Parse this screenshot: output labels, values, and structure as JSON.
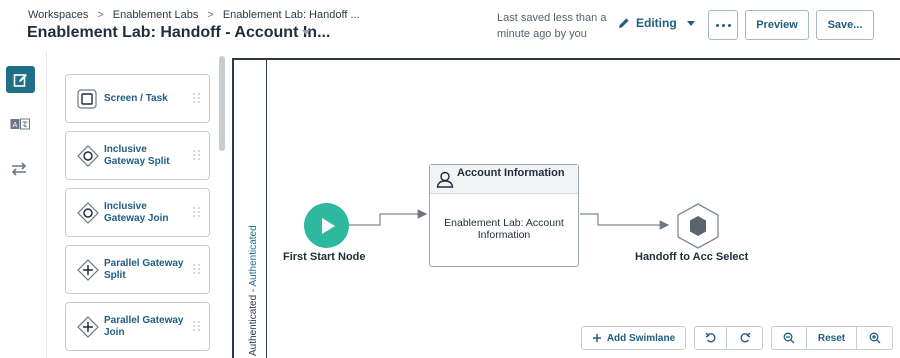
{
  "breadcrumb": {
    "items": [
      "Workspaces",
      "Enablement Labs",
      "Enablement Lab: Handoff ..."
    ]
  },
  "header": {
    "title": "Enablement Lab: Handoff - Account In...",
    "saved_status": "Last saved less than a minute ago by you",
    "mode_label": "Editing",
    "preview_label": "Preview",
    "save_label": "Save..."
  },
  "rail": {
    "icons": [
      "edit-icon",
      "translate-icon",
      "swap-icon"
    ]
  },
  "palette": {
    "items": [
      {
        "label": "Screen / Task",
        "icon": "square-icon"
      },
      {
        "label": "Inclusive Gateway Split",
        "icon": "diamond-circle-icon"
      },
      {
        "label": "Inclusive Gateway Join",
        "icon": "diamond-circle-icon"
      },
      {
        "label": "Parallel Gateway Split",
        "icon": "diamond-plus-icon"
      },
      {
        "label": "Parallel Gateway Join",
        "icon": "diamond-plus-icon"
      }
    ]
  },
  "canvas": {
    "lane_label_prefix": "Authenticated - ",
    "lane_label_accent": "Authenticated",
    "start_node_label": "First Start Node",
    "task_title": "Account Information",
    "task_body": "Enablement Lab: Account Information",
    "end_node_label": "Handoff to Acc Select"
  },
  "toolbar": {
    "add_swimlane_label": "Add Swimlane",
    "reset_label": "Reset"
  },
  "colors": {
    "accent": "#1f5d82",
    "start_node": "#2fb8a0",
    "active_rail": "#1f6f86",
    "end_node": "#5b6570"
  }
}
